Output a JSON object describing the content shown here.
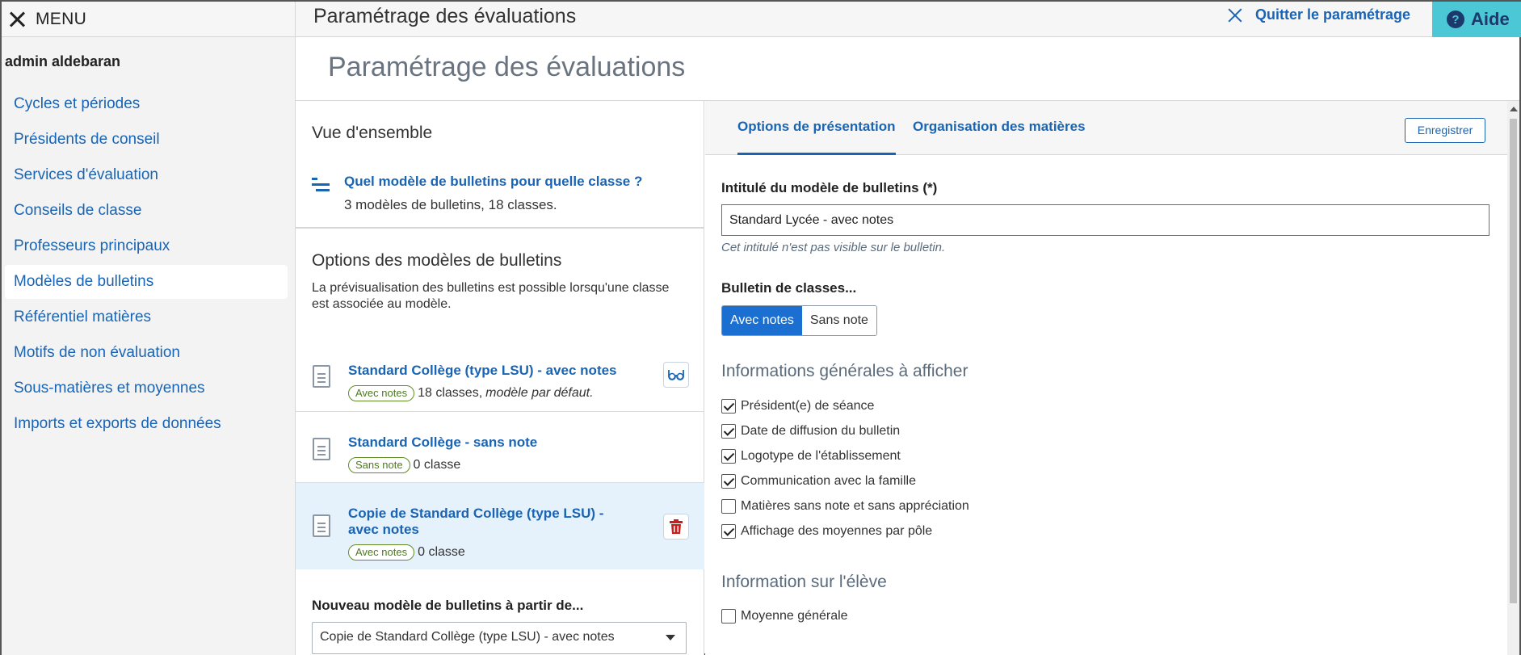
{
  "topbar": {
    "menu_label": "MENU",
    "title": "Paramétrage des évaluations",
    "quit_label": "Quitter le paramétrage",
    "help_label": "Aide"
  },
  "sidebar": {
    "user": "admin aldebaran",
    "items": [
      {
        "label": "Cycles et périodes"
      },
      {
        "label": "Présidents de conseil"
      },
      {
        "label": "Services d'évaluation"
      },
      {
        "label": "Conseils de classe"
      },
      {
        "label": "Professeurs principaux"
      },
      {
        "label": "Modèles de bulletins"
      },
      {
        "label": "Référentiel matières"
      },
      {
        "label": "Motifs de non évaluation"
      },
      {
        "label": "Sous-matières et moyennes"
      },
      {
        "label": "Imports et exports de données"
      }
    ],
    "active_index": 5
  },
  "main": {
    "page_title": "Paramétrage des évaluations",
    "overview": {
      "title": "Vue d'ensemble",
      "link": "Quel modèle de bulletins pour quelle classe ?",
      "summary": "3 modèles de bulletins, 18 classes."
    },
    "options": {
      "title": "Options des modèles de bulletins",
      "description": "La prévisualisation des bulletins est possible lorsqu'une classe est associée au modèle."
    },
    "models": [
      {
        "title": "Standard Collège (type LSU) - avec notes",
        "badge": "Avec notes",
        "classes": "18 classes,",
        "extra": "modèle par défaut."
      },
      {
        "title": "Standard Collège - sans note",
        "badge": "Sans note",
        "classes": "0 classe",
        "extra": ""
      },
      {
        "title": "Copie de Standard Collège (type LSU) - avec notes",
        "badge": "Avec notes",
        "classes": "0 classe",
        "extra": ""
      }
    ],
    "new_model": {
      "label": "Nouveau modèle de bulletins à partir de...",
      "selected": "Copie de Standard Collège (type LSU) - avec notes"
    }
  },
  "right": {
    "tabs": [
      "Options de présentation",
      "Organisation des matières"
    ],
    "save_label": "Enregistrer",
    "name_label": "Intitulé du modèle de bulletins (*)",
    "name_value": "Standard Lycée - avec notes",
    "name_hint": "Cet intitulé n'est pas visible sur le bulletin.",
    "bulletin_label": "Bulletin de classes...",
    "bulletin_options": [
      "Avec notes",
      "Sans note"
    ],
    "general_section": "Informations générales à afficher",
    "general_checks": [
      {
        "label": "Président(e) de séance",
        "checked": true
      },
      {
        "label": "Date de diffusion du bulletin",
        "checked": true
      },
      {
        "label": "Logotype de l'établissement",
        "checked": true
      },
      {
        "label": "Communication avec la famille",
        "checked": true
      },
      {
        "label": "Matières sans note et sans appréciation",
        "checked": false
      },
      {
        "label": "Affichage des moyennes par pôle",
        "checked": true
      }
    ],
    "student_section": "Information sur l'élève",
    "student_checks": [
      {
        "label": "Moyenne générale",
        "checked": false
      }
    ]
  },
  "colors": {
    "link": "#1a64b4",
    "help_bg": "#4bc7d6",
    "selected_row": "#e5f1fb",
    "segment_on": "#1a6fd1"
  }
}
